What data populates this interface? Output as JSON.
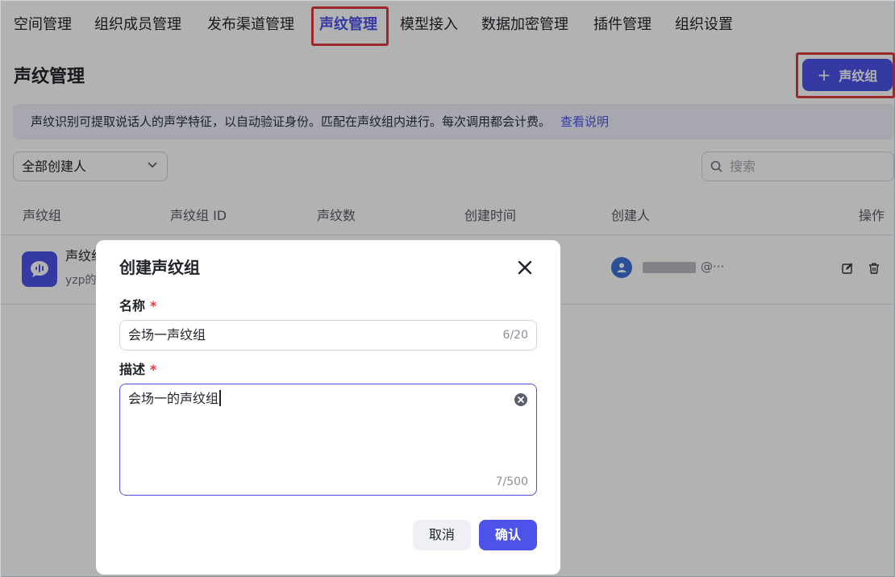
{
  "nav": {
    "items": [
      {
        "label": "空间管理",
        "active": false
      },
      {
        "label": "组织成员管理",
        "active": false
      },
      {
        "label": "发布渠道管理",
        "active": false
      },
      {
        "label": "声纹管理",
        "active": true
      },
      {
        "label": "模型接入",
        "active": false
      },
      {
        "label": "数据加密管理",
        "active": false
      },
      {
        "label": "插件管理",
        "active": false
      },
      {
        "label": "组织设置",
        "active": false
      }
    ]
  },
  "page": {
    "title": "声纹管理",
    "create_button_label": "声纹组",
    "banner_text": "声纹识别可提取说话人的声学特征，以自动验证身份。匹配在声纹组内进行。每次调用都会计费。",
    "banner_link": "查看说明"
  },
  "filters": {
    "creator_filter": "全部创建人",
    "search_placeholder": "搜索"
  },
  "table": {
    "headers": [
      "声纹组",
      "声纹组 ID",
      "声纹数",
      "创建时间",
      "创建人",
      "操作"
    ],
    "rows": [
      {
        "name": "声纹组",
        "description": "yzp的",
        "creator_handle": "@···"
      }
    ]
  },
  "modal": {
    "title": "创建声纹组",
    "name_label": "名称",
    "name_value": "会场一声纹组",
    "name_count": "6/20",
    "desc_label": "描述",
    "desc_value": "会场一的声纹组",
    "desc_count": "7/500",
    "required_mark": "*",
    "cancel_label": "取消",
    "confirm_label": "确认"
  },
  "colors": {
    "accent": "#4d53e8",
    "highlight_border": "#e03b3b",
    "overlay": "rgba(0,0,0,0.30)"
  }
}
